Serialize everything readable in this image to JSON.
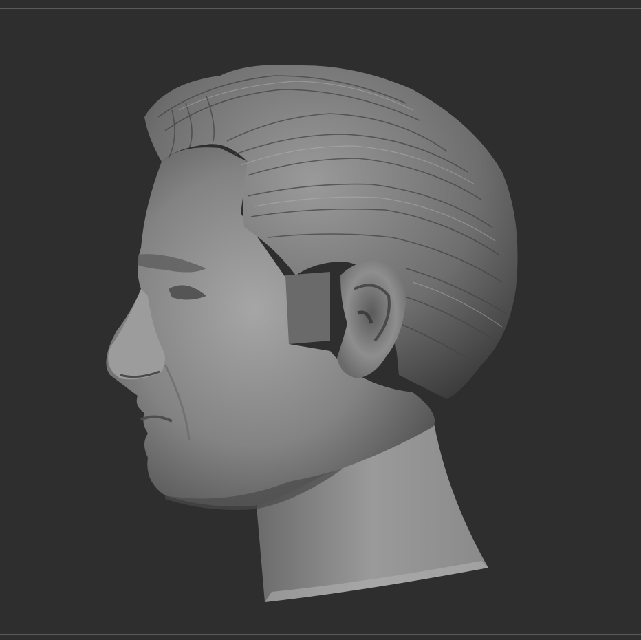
{
  "viewport": {
    "background": "#2e2e2e",
    "frame_line_color": "#5a5a5a"
  },
  "model": {
    "subject": "sculpted-male-head-profile",
    "material_base": "#8a8a8a",
    "material_highlight": "#b4b4b4",
    "material_shadow": "#3c3c3c"
  }
}
